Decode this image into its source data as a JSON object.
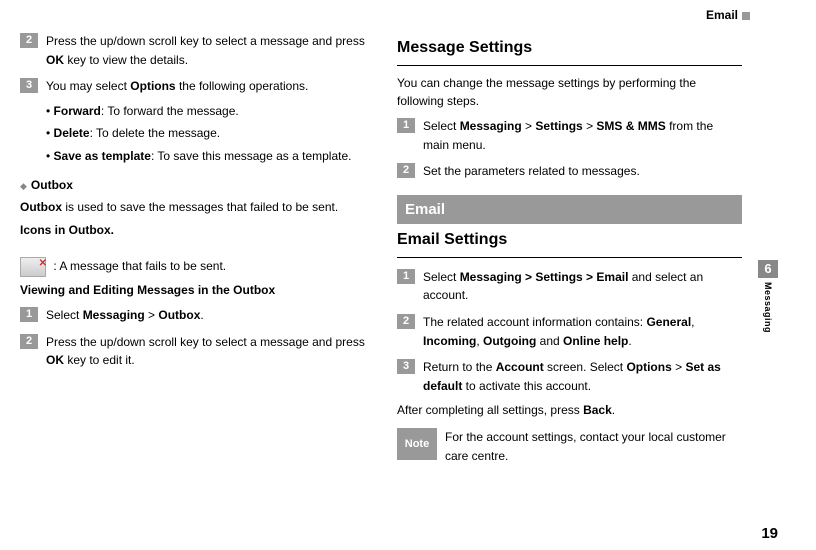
{
  "header": {
    "title": "Email"
  },
  "left": {
    "step2": {
      "num": "2",
      "pre": "Press the up/down scroll key to select a message and press ",
      "ok": "OK",
      "post": " key to view the details."
    },
    "step3": {
      "num": "3",
      "pre": "You may select ",
      "options": "Options",
      "post": " the following operations."
    },
    "bullets": {
      "forward": {
        "label": "Forward",
        "text": ": To forward the message."
      },
      "delete": {
        "label": "Delete",
        "text": ": To delete the message."
      },
      "save": {
        "label": "Save as template",
        "text": ": To save this message as a template."
      }
    },
    "outbox_header": "Outbox",
    "outbox_desc_pre": "Outbox",
    "outbox_desc_post": " is used to save the messages that failed to be sent.",
    "icons_heading": "Icons in Outbox.",
    "icon_desc": ": A message that fails to be sent.",
    "view_edit_heading": "Viewing and Editing Messages in the Outbox",
    "ve_step1": {
      "num": "1",
      "pre": "Select ",
      "messaging": "Messaging",
      "gt": " > ",
      "outbox": "Outbox",
      "post": "."
    },
    "ve_step2": {
      "num": "2",
      "pre": "Press the up/down scroll key to select a message and press ",
      "ok": "OK",
      "post": " key to edit it."
    }
  },
  "right": {
    "msg_settings_heading": "Message Settings",
    "msg_settings_intro": "You can change the message settings by performing the following steps.",
    "ms_step1": {
      "num": "1",
      "pre": "Select ",
      "messaging": "Messaging",
      "gt1": " > ",
      "settings": "Settings",
      "gt2": " > ",
      "sms": "SMS & MMS",
      "post": " from the main menu."
    },
    "ms_step2": {
      "num": "2",
      "text": "Set the parameters related to messages."
    },
    "email_banner": "Email",
    "email_settings_heading": "Email Settings",
    "es_step1": {
      "num": "1",
      "pre": "Select ",
      "path": "Messaging > Settings > Email",
      "post": " and select an account."
    },
    "es_step2": {
      "num": "2",
      "pre": "The related account information contains: ",
      "general": "General",
      "sep1": ", ",
      "incoming": "Incoming",
      "sep2": ", ",
      "outgoing": "Outgoing",
      "sep3": " and ",
      "online": "Online help",
      "post": "."
    },
    "es_step3": {
      "num": "3",
      "pre": "Return to the ",
      "account": "Account",
      "mid": " screen. Select ",
      "options": "Options",
      "gt": " > ",
      "setdefault": "Set as default",
      "post": " to activate this account."
    },
    "after": {
      "pre": "After completing all settings, press ",
      "back": "Back",
      "post": "."
    },
    "note": {
      "label": "Note",
      "text": "For the account settings, contact your local customer care centre."
    }
  },
  "side": {
    "chapter_num": "6",
    "chapter_label": "Messaging"
  },
  "page_number": "19"
}
